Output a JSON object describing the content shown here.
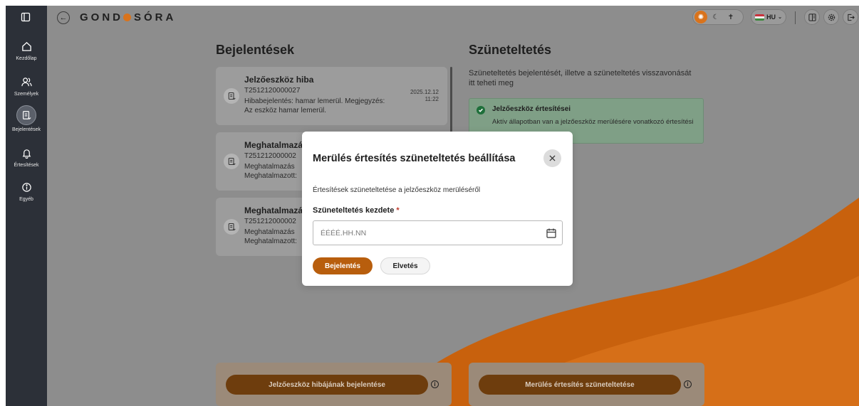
{
  "sidebar": {
    "items": [
      {
        "label": "Kezdőlap",
        "icon": "home-icon"
      },
      {
        "label": "Személyek",
        "icon": "people-icon"
      },
      {
        "label": "Bejelentések",
        "icon": "document-icon"
      },
      {
        "label": "Értesítések",
        "icon": "bell-icon"
      },
      {
        "label": "Egyéb",
        "icon": "info-icon"
      }
    ],
    "active": "Bejelentések"
  },
  "header": {
    "logo_left": "GOND",
    "logo_right": "SÓRA",
    "language": "HU"
  },
  "left_column": {
    "title": "Bejelentések",
    "cards": [
      {
        "title": "Jelzőeszköz hiba",
        "id": "T2512120000027",
        "text": "Hibabejelentés: hamar lemerül. Megjegyzés: Az eszköz hamar lemerül.",
        "date": "2025.12.12",
        "time": "11:22"
      },
      {
        "title": "Meghatalmazá",
        "id": "T251212000002",
        "line1": "Meghatalmazás",
        "line2": "Meghatalmazott:"
      },
      {
        "title": "Meghatalmazá",
        "id": "T251212000002",
        "line1": "Meghatalmazás",
        "line2": "Meghatalmazott:"
      }
    ]
  },
  "right_column": {
    "title": "Szüneteltetés",
    "description": "Szüneteltetés bejelentését, illetve a szüneteltetés visszavonását itt teheti meg",
    "status": {
      "title": "Jelzőeszköz értesítései",
      "text": "Aktív állapotban van a jelzőeszköz merülésére vonatkozó értesítési"
    }
  },
  "actions": {
    "left_button": "Jelzőeszköz hibájának bejelentése",
    "right_button": "Merülés értesítés szüneteltetése"
  },
  "modal": {
    "title": "Merülés értesítés szüneteltetés beállítása",
    "description": "Értesítések szüneteltetése a jelzőeszköz merüléséről",
    "field_label": "Szüneteltetés kezdete",
    "required_mark": "*",
    "date_value": "",
    "date_placeholder": "ÉÉÉÉ.HH.NN",
    "submit_label": "Bejelentés",
    "cancel_label": "Elvetés"
  },
  "colors": {
    "accent": "#b85e0d",
    "sidebar_bg": "#2c3038",
    "overlay_bg": "#8d8d8d",
    "success": "#1e6f3a"
  }
}
